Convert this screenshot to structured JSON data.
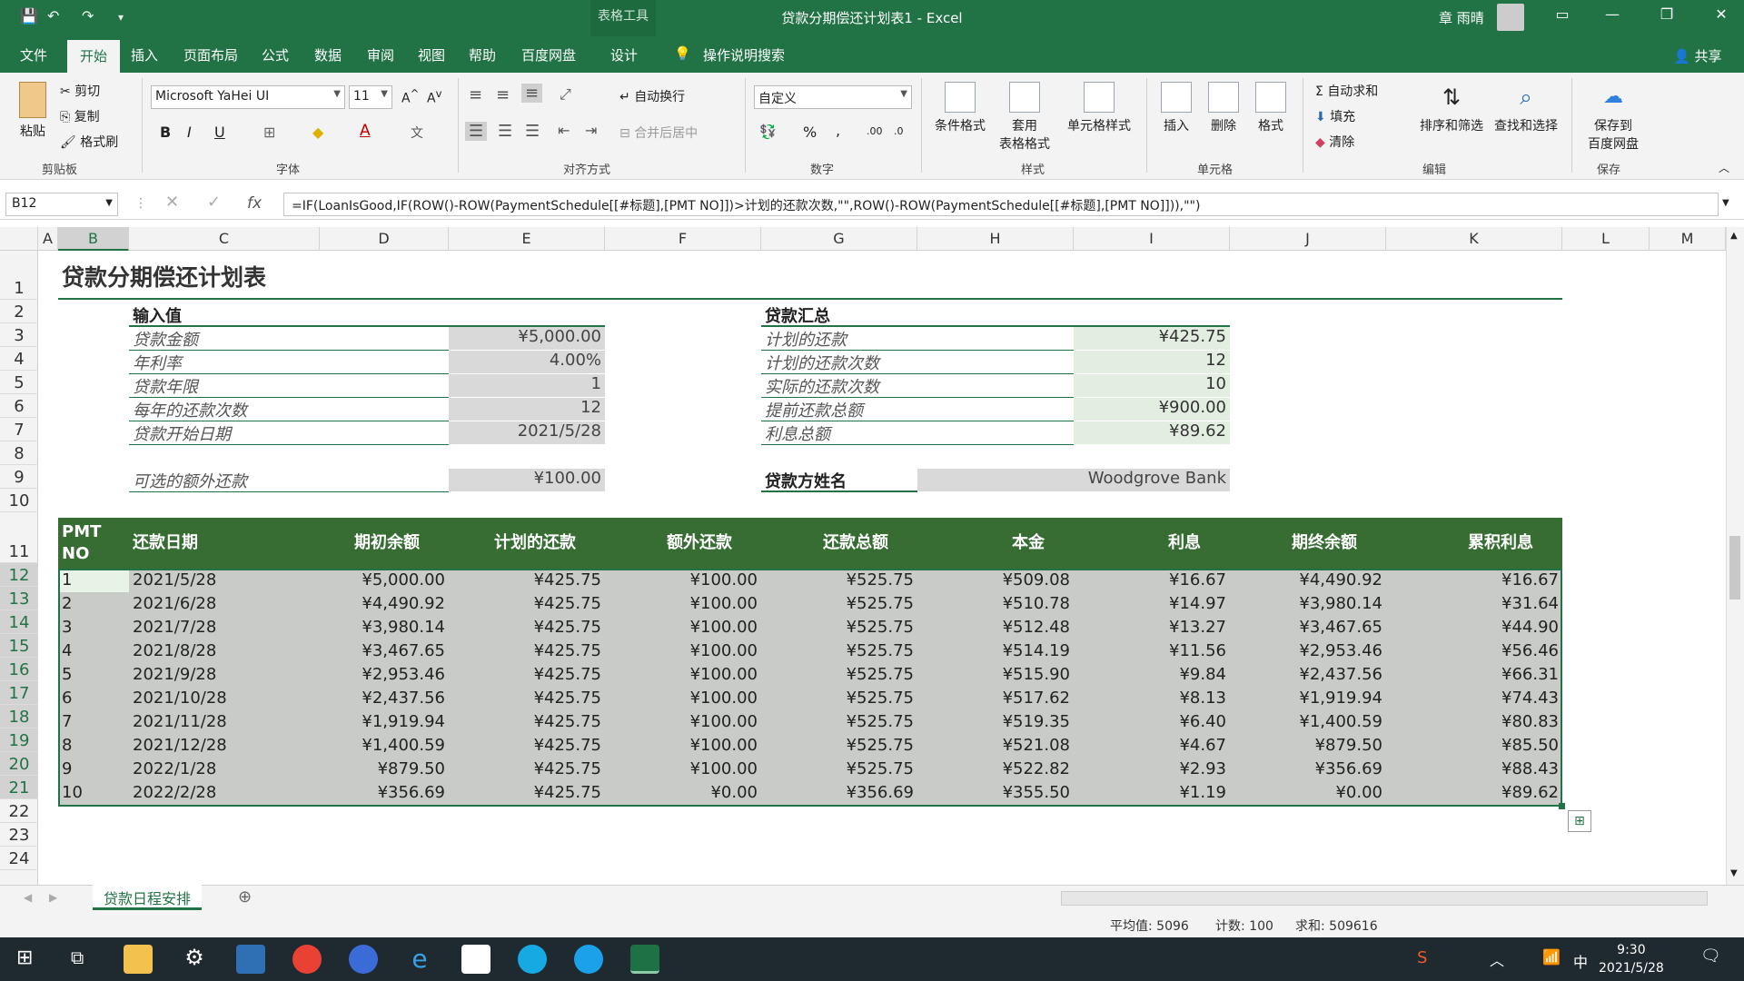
{
  "titlebar": {
    "context_tab": "表格工具",
    "title": "贷款分期偿还计划表1 - Excel",
    "user": "章 雨晴"
  },
  "menu": {
    "tabs": [
      "文件",
      "开始",
      "插入",
      "页面布局",
      "公式",
      "数据",
      "审阅",
      "视图",
      "帮助",
      "百度网盘",
      "设计"
    ],
    "active": "开始",
    "tellme": "操作说明搜索",
    "share": "共享"
  },
  "ribbon": {
    "paste": "粘贴",
    "cut": "剪切",
    "copy": "复制",
    "format_painter": "格式刷",
    "clipboard_label": "剪贴板",
    "font_name": "Microsoft YaHei UI",
    "font_size": "11",
    "font_label": "字体",
    "wrap_text": "自动换行",
    "merge_center": "合并后居中",
    "align_label": "对齐方式",
    "number_format": "自定义",
    "number_label": "数字",
    "cond_format": "条件格式",
    "table_format_1": "套用",
    "table_format_2": "表格格式",
    "cell_styles": "单元格样式",
    "styles_label": "样式",
    "insert": "插入",
    "delete": "删除",
    "format": "格式",
    "cells_label": "单元格",
    "autosum": "自动求和",
    "fill": "填充",
    "clear": "清除",
    "sort_filter": "排序和筛选",
    "find_select": "查找和选择",
    "editing_label": "编辑",
    "save_baidu_1": "保存到",
    "save_baidu_2": "百度网盘",
    "save_label": "保存"
  },
  "formula_bar": {
    "name_box": "B12",
    "fx": "fx",
    "formula": "=IF(LoanIsGood,IF(ROW()-ROW(PaymentSchedule[[#标题],[PMT NO]])>计划的还款次数,\"\",ROW()-ROW(PaymentSchedule[[#标题],[PMT NO]])),\"\")"
  },
  "columns": [
    "A",
    "B",
    "C",
    "D",
    "E",
    "F",
    "G",
    "H",
    "I",
    "J",
    "K",
    "L",
    "M"
  ],
  "rows": [
    "1",
    "2",
    "3",
    "4",
    "5",
    "6",
    "7",
    "8",
    "9",
    "10",
    "11",
    "12",
    "13",
    "14",
    "15",
    "16",
    "17",
    "18",
    "19",
    "20",
    "21",
    "22",
    "23",
    "24"
  ],
  "sheet": {
    "title": "贷款分期偿还计划表",
    "inputs_header": "输入值",
    "inputs": [
      {
        "label": "贷款金额",
        "value": "¥5,000.00"
      },
      {
        "label": "年利率",
        "value": "4.00%"
      },
      {
        "label": "贷款年限",
        "value": "1"
      },
      {
        "label": "每年的还款次数",
        "value": "12"
      },
      {
        "label": "贷款开始日期",
        "value": "2021/5/28"
      }
    ],
    "extra": {
      "label": "可选的额外还款",
      "value": "¥100.00"
    },
    "summary_header": "贷款汇总",
    "summary": [
      {
        "label": "计划的还款",
        "value": "¥425.75"
      },
      {
        "label": "计划的还款次数",
        "value": "12"
      },
      {
        "label": "实际的还款次数",
        "value": "10"
      },
      {
        "label": "提前还款总额",
        "value": "¥900.00"
      },
      {
        "label": "利息总额",
        "value": "¥89.62"
      }
    ],
    "lender": {
      "label": "贷款方姓名",
      "value": "Woodgrove Bank"
    },
    "table_headers": [
      "PMT NO",
      "还款日期",
      "期初余额",
      "计划的还款",
      "额外还款",
      "还款总额",
      "本金",
      "利息",
      "期终余额",
      "累积利息"
    ],
    "table_rows": [
      [
        "1",
        "2021/5/28",
        "¥5,000.00",
        "¥425.75",
        "¥100.00",
        "¥525.75",
        "¥509.08",
        "¥16.67",
        "¥4,490.92",
        "¥16.67"
      ],
      [
        "2",
        "2021/6/28",
        "¥4,490.92",
        "¥425.75",
        "¥100.00",
        "¥525.75",
        "¥510.78",
        "¥14.97",
        "¥3,980.14",
        "¥31.64"
      ],
      [
        "3",
        "2021/7/28",
        "¥3,980.14",
        "¥425.75",
        "¥100.00",
        "¥525.75",
        "¥512.48",
        "¥13.27",
        "¥3,467.65",
        "¥44.90"
      ],
      [
        "4",
        "2021/8/28",
        "¥3,467.65",
        "¥425.75",
        "¥100.00",
        "¥525.75",
        "¥514.19",
        "¥11.56",
        "¥2,953.46",
        "¥56.46"
      ],
      [
        "5",
        "2021/9/28",
        "¥2,953.46",
        "¥425.75",
        "¥100.00",
        "¥525.75",
        "¥515.90",
        "¥9.84",
        "¥2,437.56",
        "¥66.31"
      ],
      [
        "6",
        "2021/10/28",
        "¥2,437.56",
        "¥425.75",
        "¥100.00",
        "¥525.75",
        "¥517.62",
        "¥8.13",
        "¥1,919.94",
        "¥74.43"
      ],
      [
        "7",
        "2021/11/28",
        "¥1,919.94",
        "¥425.75",
        "¥100.00",
        "¥525.75",
        "¥519.35",
        "¥6.40",
        "¥1,400.59",
        "¥80.83"
      ],
      [
        "8",
        "2021/12/28",
        "¥1,400.59",
        "¥425.75",
        "¥100.00",
        "¥525.75",
        "¥521.08",
        "¥4.67",
        "¥879.50",
        "¥85.50"
      ],
      [
        "9",
        "2022/1/28",
        "¥879.50",
        "¥425.75",
        "¥100.00",
        "¥525.75",
        "¥522.82",
        "¥2.93",
        "¥356.69",
        "¥88.43"
      ],
      [
        "10",
        "2022/2/28",
        "¥356.69",
        "¥425.75",
        "¥0.00",
        "¥356.69",
        "¥355.50",
        "¥1.19",
        "¥0.00",
        "¥89.62"
      ]
    ]
  },
  "sheet_tab": "贷款日程安排",
  "status": {
    "average": "平均值: 5096",
    "count": "计数: 100",
    "sum": "求和: 509616"
  },
  "taskbar": {
    "time": "9:30",
    "date": "2021/5/28",
    "ime": "中"
  },
  "colors": {
    "excel_green": "#217346",
    "table_header": "#376d33",
    "table_body": "#c8cbc8",
    "input_gray": "#d9d9d9",
    "summary_green": "#e2efe0"
  }
}
